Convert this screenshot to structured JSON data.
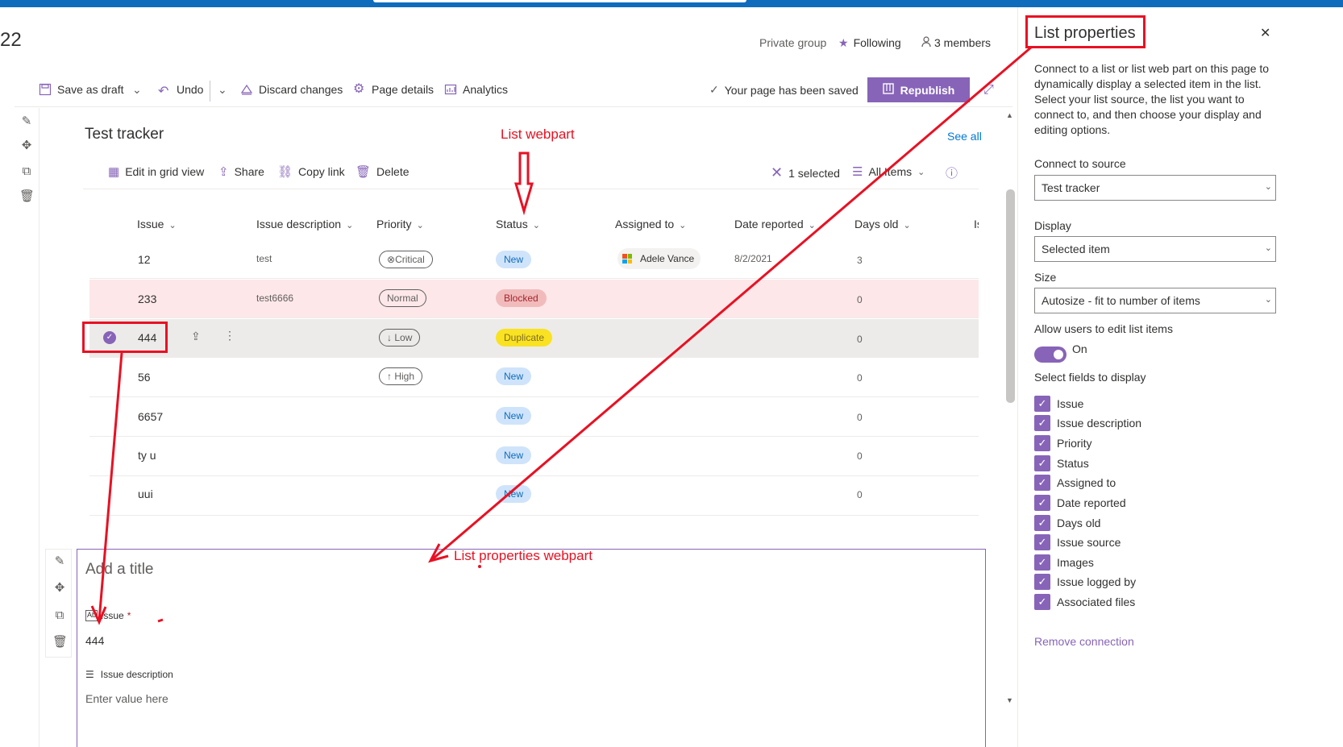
{
  "site": {
    "title_fragment": "22",
    "privacy": "Private group",
    "following": "Following",
    "members": "3 members"
  },
  "command_bar": {
    "save_draft": "Save as draft",
    "undo": "Undo",
    "discard": "Discard changes",
    "page_details": "Page details",
    "analytics": "Analytics",
    "saved_status": "Your page has been saved",
    "republish": "Republish"
  },
  "list": {
    "title": "Test tracker",
    "see_all": "See all",
    "toolbar": {
      "edit_grid": "Edit in grid view",
      "share": "Share",
      "copy_link": "Copy link",
      "delete": "Delete",
      "selected_count": "1 selected",
      "view": "All Items"
    },
    "columns": [
      "Issue",
      "Issue description",
      "Priority",
      "Status",
      "Assigned to",
      "Date reported",
      "Days old",
      "Is"
    ],
    "rows": [
      {
        "issue": "12",
        "description": "test",
        "priority": "Critical",
        "priority_icon": "⊗",
        "status": "New",
        "assigned": "Adele Vance",
        "date": "8/2/2021",
        "days": "3"
      },
      {
        "issue": "233",
        "description": "test6666",
        "priority": "Normal",
        "priority_icon": "",
        "status": "Blocked",
        "assigned": "",
        "date": "",
        "days": "0"
      },
      {
        "issue": "444",
        "description": "",
        "priority": "Low",
        "priority_icon": "↓",
        "status": "Duplicate",
        "assigned": "",
        "date": "",
        "days": "0"
      },
      {
        "issue": "56",
        "description": "",
        "priority": "High",
        "priority_icon": "↑",
        "status": "New",
        "assigned": "",
        "date": "",
        "days": "0"
      },
      {
        "issue": "6657",
        "description": "",
        "priority": "",
        "priority_icon": "",
        "status": "New",
        "assigned": "",
        "date": "",
        "days": "0"
      },
      {
        "issue": "ty u",
        "description": "",
        "priority": "",
        "priority_icon": "",
        "status": "New",
        "assigned": "",
        "date": "",
        "days": "0"
      },
      {
        "issue": "uui",
        "description": "",
        "priority": "",
        "priority_icon": "",
        "status": "New",
        "assigned": "",
        "date": "",
        "days": "0"
      }
    ]
  },
  "list_properties_webpart": {
    "title_placeholder": "Add a title",
    "issue_label": "Issue",
    "issue_required": "*",
    "issue_value": "444",
    "description_label": "Issue description",
    "description_placeholder": "Enter value here"
  },
  "panel": {
    "title": "List properties",
    "description": "Connect to a list or list web part on this page to dynamically display a selected item in the list. Select your list source, the list you want to connect to, and then choose your display and editing options.",
    "connect_label": "Connect to source",
    "connect_value": "Test tracker",
    "display_label": "Display",
    "display_value": "Selected item",
    "size_label": "Size",
    "size_value": "Autosize - fit to number of items",
    "allow_edit_label": "Allow users to edit list items",
    "allow_edit_state": "On",
    "fields_label": "Select fields to display",
    "fields": [
      "Issue",
      "Issue description",
      "Priority",
      "Status",
      "Assigned to",
      "Date reported",
      "Days old",
      "Issue source",
      "Images",
      "Issue logged by",
      "Associated files"
    ],
    "remove_connection": "Remove connection"
  },
  "annotations": {
    "list_webpart": "List webpart",
    "list_properties_webpart": "List properties webpart"
  },
  "colors": {
    "accent": "#8764b8",
    "annotation_red": "#e81123",
    "blocked_row": "#fde7e9",
    "selected_row": "#edebe9"
  }
}
